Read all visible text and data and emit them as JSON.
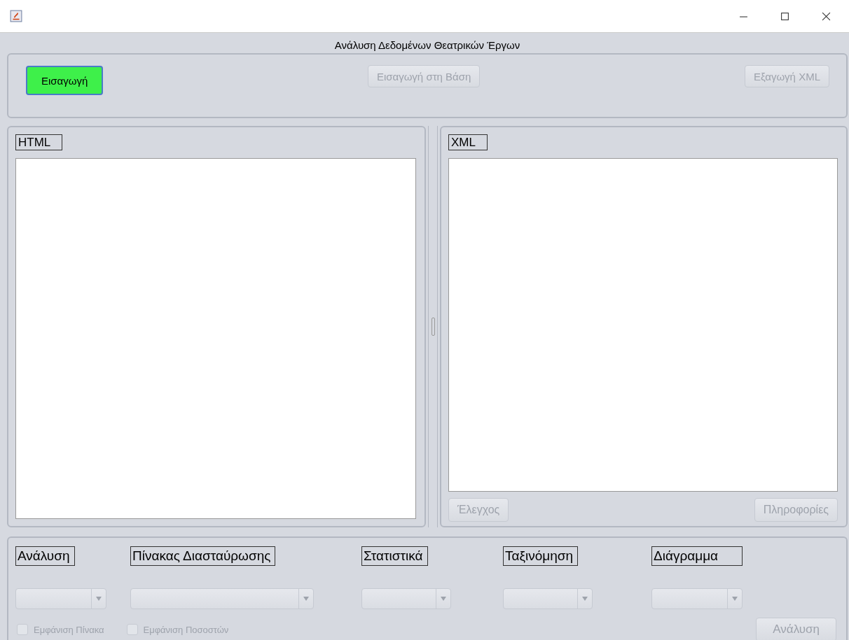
{
  "app_title": "Ανάλυση Δεδομένων Θεατρικών Έργων",
  "toolbar": {
    "buttons": [
      {
        "label": "Εισαγωγή",
        "disabled": false,
        "highlighted": true
      },
      {
        "label": "Εισαγωγή στη Βάση",
        "disabled": true,
        "highlighted": false
      },
      {
        "label": "Εξαγωγή XML",
        "disabled": true,
        "highlighted": false
      }
    ]
  },
  "html_panel": {
    "label": "HTML"
  },
  "xml_panel": {
    "label": "XML",
    "buttons": [
      {
        "label": "Έλεγχος",
        "disabled": true
      },
      {
        "label": "Πληροφορίες",
        "disabled": true
      }
    ]
  },
  "analysis": {
    "groups": [
      {
        "label": "Ανάλυση",
        "disabled": true
      },
      {
        "label": "Πίνακας Διασταύρωσης",
        "disabled": true
      },
      {
        "label": "Στατιστικά",
        "disabled": true
      },
      {
        "label": "Ταξινόμηση",
        "disabled": true
      },
      {
        "label": "Διάγραμμα",
        "disabled": true
      }
    ],
    "checkboxes": [
      {
        "label": "Εμφάνιση Πίνακα",
        "checked": false,
        "disabled": true
      },
      {
        "label": "Εμφάνιση Ποσοστών",
        "checked": false,
        "disabled": true
      }
    ],
    "button": {
      "label": "Ανάλυση",
      "disabled": true
    }
  }
}
